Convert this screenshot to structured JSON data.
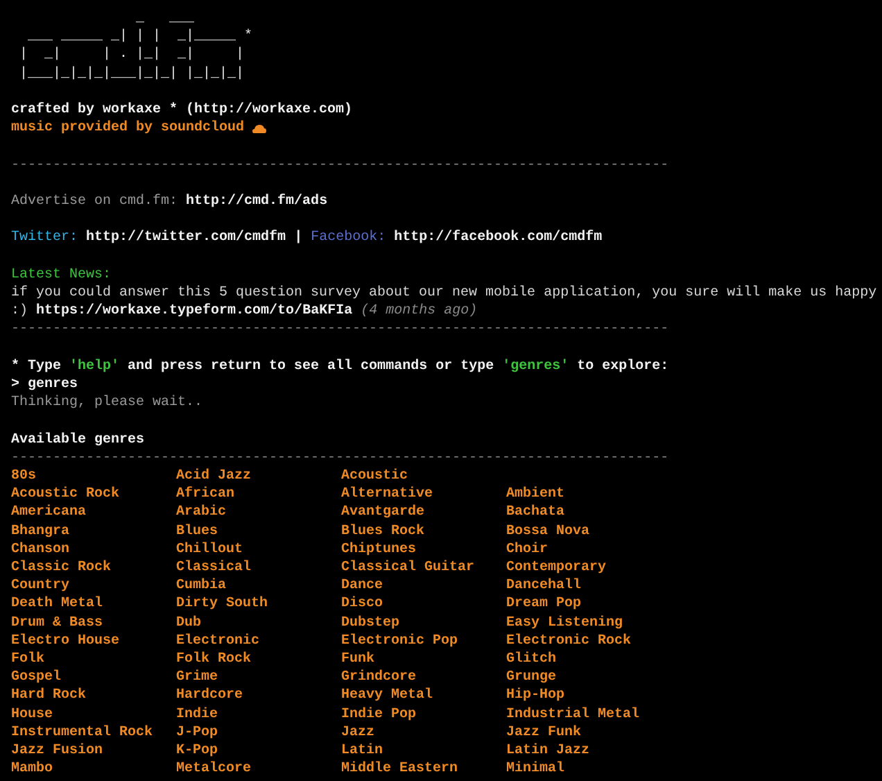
{
  "logo": {
    "art": "               _   ___\n  ___ _____ _| | |  _|_____ *\n |  _|     | . |_|  _|     |\n |___|_|_|_|___|_|_| |_|_|_|"
  },
  "credit": "crafted by workaxe * (http://workaxe.com)",
  "music_credit": "music provided by soundcloud",
  "rules": [
    "-------------------------------------------------------------------------------",
    "-------------------------------------------------------------------------------",
    "-------------------------------------------------------------------------------"
  ],
  "advertise": {
    "label": "Advertise on cmd.fm:",
    "url": "http://cmd.fm/ads"
  },
  "social": {
    "twitter_label": "Twitter:",
    "twitter_url": "http://twitter.com/cmdfm",
    "divider": "|",
    "facebook_label": "Facebook:",
    "facebook_url": "http://facebook.com/cmdfm"
  },
  "news": {
    "heading": "Latest News:",
    "text": "if you could answer this 5 question survey about our new mobile application, you sure will make us happy",
    "prefix": ":)",
    "url": "https://workaxe.typeform.com/to/BaKFIa",
    "age": "(4 months ago)"
  },
  "prompt": {
    "hint_parts": [
      {
        "kind": "plain",
        "text": "* Type "
      },
      {
        "kind": "keyword",
        "text": "'help'"
      },
      {
        "kind": "plain",
        "text": " and press return to see all commands or type "
      },
      {
        "kind": "keyword",
        "text": "'genres'"
      },
      {
        "kind": "plain",
        "text": " to explore:"
      }
    ],
    "marker": ">",
    "input": "genres",
    "status": "Thinking, please wait.."
  },
  "genres": {
    "heading": "Available genres",
    "rows": [
      [
        "80s",
        "Acid Jazz",
        "Acoustic"
      ],
      [
        "Acoustic Rock",
        "African",
        "Alternative",
        "Ambient"
      ],
      [
        "Americana",
        "Arabic",
        "Avantgarde",
        "Bachata"
      ],
      [
        "Bhangra",
        "Blues",
        "Blues Rock",
        "Bossa Nova"
      ],
      [
        "Chanson",
        "Chillout",
        "Chiptunes",
        "Choir"
      ],
      [
        "Classic Rock",
        "Classical",
        "Classical Guitar",
        "Contemporary"
      ],
      [
        "Country",
        "Cumbia",
        "Dance",
        "Dancehall"
      ],
      [
        "Death Metal",
        "Dirty South",
        "Disco",
        "Dream Pop"
      ],
      [
        "Drum & Bass",
        "Dub",
        "Dubstep",
        "Easy Listening"
      ],
      [
        "Electro House",
        "Electronic",
        "Electronic Pop",
        "Electronic Rock"
      ],
      [
        "Folk",
        "Folk Rock",
        "Funk",
        "Glitch"
      ],
      [
        "Gospel",
        "Grime",
        "Grindcore",
        "Grunge"
      ],
      [
        "Hard Rock",
        "Hardcore",
        "Heavy Metal",
        "Hip-Hop"
      ],
      [
        "House",
        "Indie",
        "Indie Pop",
        "Industrial Metal"
      ],
      [
        "Instrumental Rock",
        "J-Pop",
        "Jazz",
        "Jazz Funk"
      ],
      [
        "Jazz Fusion",
        "K-Pop",
        "Latin",
        "Latin Jazz"
      ],
      [
        "Mambo",
        "Metalcore",
        "Middle Eastern",
        "Minimal"
      ]
    ]
  }
}
